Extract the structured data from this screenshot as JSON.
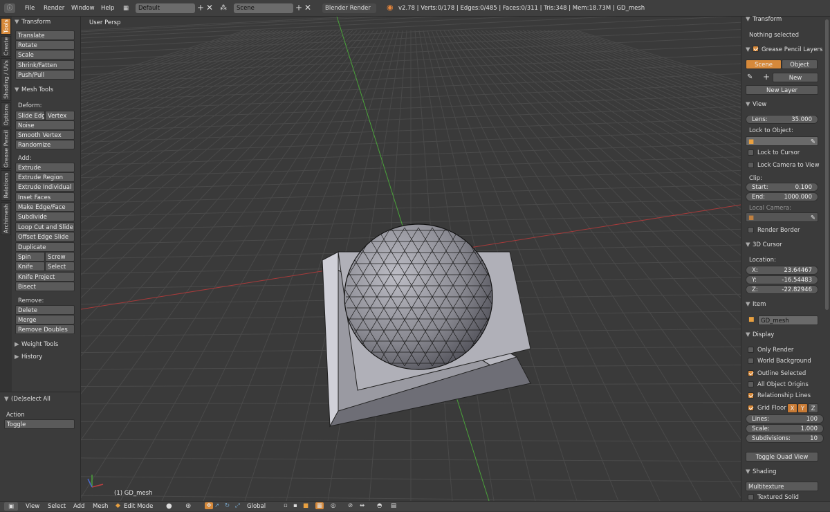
{
  "topbar": {
    "menus": [
      "File",
      "Render",
      "Window",
      "Help"
    ],
    "screen_layout": "Default",
    "scene": "Scene",
    "engine": "Blender Render",
    "stats": "v2.78 | Verts:0/178 | Edges:0/485 | Faces:0/311 | Tris:348 | Mem:18.73M | GD_mesh"
  },
  "tabs": [
    "Tools",
    "Create",
    "Shading / UVs",
    "Options",
    "Grease Pencil",
    "Relations",
    "Archimesh"
  ],
  "tools": {
    "transform_title": "Transform",
    "transform": [
      "Translate",
      "Rotate",
      "Scale",
      "Shrink/Fatten",
      "Push/Pull"
    ],
    "mesh_tools_title": "Mesh Tools",
    "deform_label": "Deform:",
    "slide_edge": "Slide Edge",
    "vertex": "Vertex",
    "noise": "Noise",
    "smooth_vertex": "Smooth Vertex",
    "randomize": "Randomize",
    "add_label": "Add:",
    "extrude": "Extrude",
    "extrude_region": "Extrude Region",
    "extrude_individual": "Extrude Individual",
    "inset_faces": "Inset Faces",
    "make_edge_face": "Make Edge/Face",
    "subdivide": "Subdivide",
    "loop_cut": "Loop Cut and Slide",
    "offset_edge": "Offset Edge Slide",
    "duplicate": "Duplicate",
    "spin": "Spin",
    "screw": "Screw",
    "knife": "Knife",
    "select": "Select",
    "knife_project": "Knife Project",
    "bisect": "Bisect",
    "remove_label": "Remove:",
    "delete": "Delete",
    "merge": "Merge",
    "remove_doubles": "Remove Doubles",
    "weight_tools": "Weight Tools",
    "history": "History"
  },
  "operator": {
    "title": "(De)select All",
    "action_label": "Action",
    "action_value": "Toggle"
  },
  "viewport": {
    "view_name": "User Persp",
    "object_label": "(1) GD_mesh"
  },
  "props": {
    "transform_title": "Transform",
    "nothing_selected": "Nothing selected",
    "gp_title": "Grease Pencil Layers",
    "gp_scene": "Scene",
    "gp_object": "Object",
    "gp_new": "New",
    "gp_new_layer": "New Layer",
    "view_title": "View",
    "lens_label": "Lens:",
    "lens_value": "35.000",
    "lock_to_object": "Lock to Object:",
    "lock_to_cursor": "Lock to Cursor",
    "lock_camera": "Lock Camera to View",
    "clip_label": "Clip:",
    "start_label": "Start:",
    "start_value": "0.100",
    "end_label": "End:",
    "end_value": "1000.000",
    "local_camera": "Local Camera:",
    "render_border": "Render Border",
    "cursor_title": "3D Cursor",
    "location_label": "Location:",
    "x_label": "X:",
    "x_value": "23.64467",
    "y_label": "Y:",
    "y_value": "-16.54483",
    "z_label": "Z:",
    "z_value": "-22.82946",
    "item_title": "Item",
    "item_name": "GD_mesh",
    "display_title": "Display",
    "only_render": "Only Render",
    "world_background": "World Background",
    "outline_selected": "Outline Selected",
    "all_object_origins": "All Object Origins",
    "relationship_lines": "Relationship Lines",
    "grid_floor": "Grid Floor",
    "axis_x": "X",
    "axis_y": "Y",
    "axis_z": "Z",
    "lines_label": "Lines:",
    "lines_value": "100",
    "scale_label": "Scale:",
    "scale_value": "1.000",
    "subdiv_label": "Subdivisions:",
    "subdiv_value": "10",
    "toggle_quad": "Toggle Quad View",
    "shading_title": "Shading",
    "shading_mode": "Multitexture",
    "textured_solid": "Textured Solid"
  },
  "bottombar": {
    "menus": [
      "View",
      "Select",
      "Add",
      "Mesh"
    ],
    "mode": "Edit Mode",
    "orientation": "Global"
  },
  "colors": {
    "accent": "#d6893a",
    "x_axis": "#b03a3a",
    "y_axis": "#4a9a3a"
  }
}
